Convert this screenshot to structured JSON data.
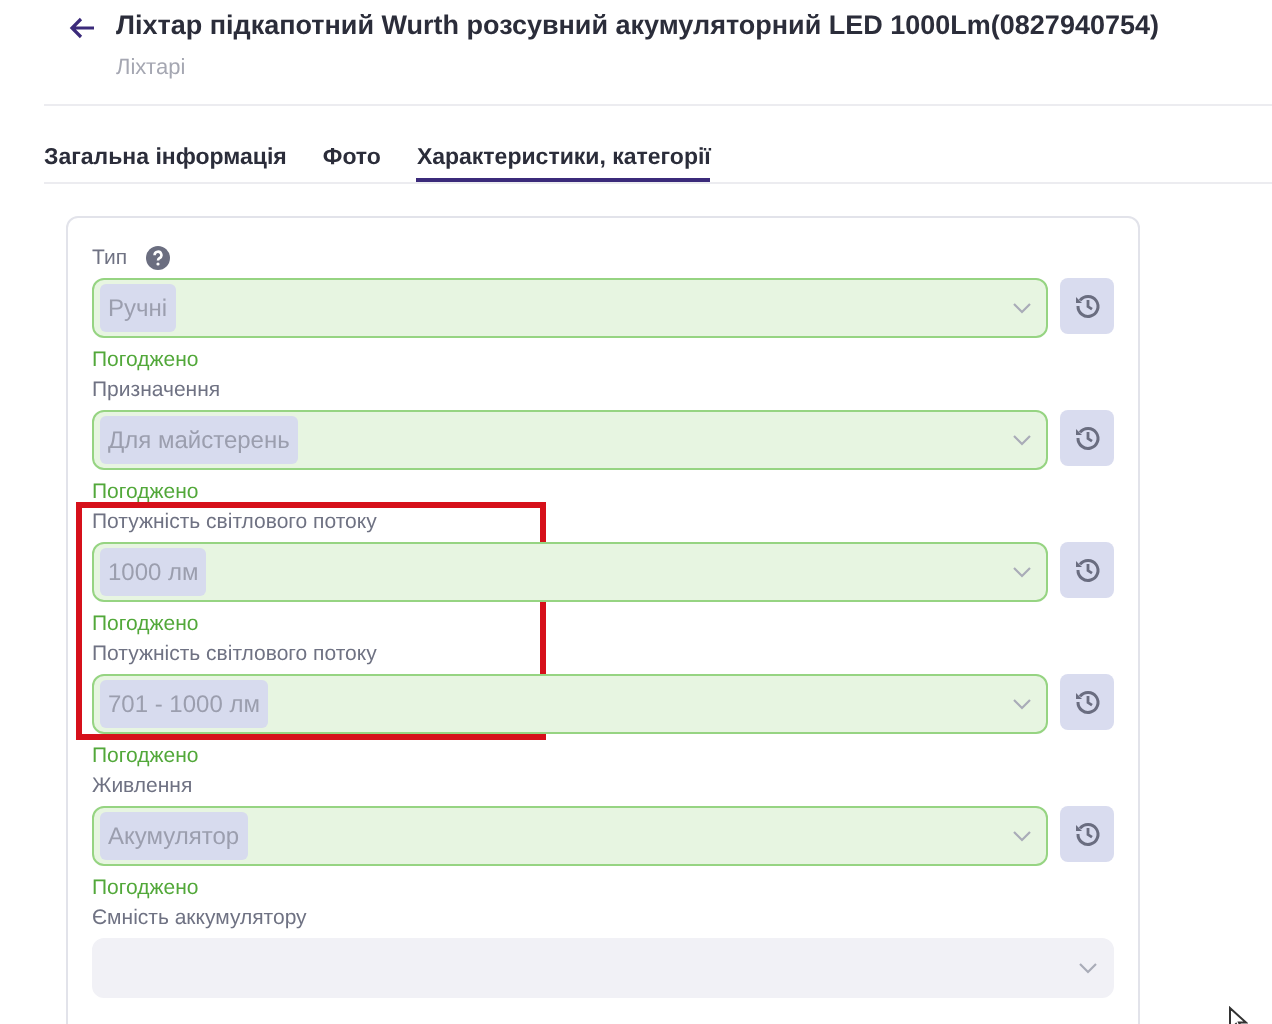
{
  "header": {
    "title": "Ліхтар підкапотний Wurth розсувний акумуляторний LED 1000Lm(0827940754)",
    "subtitle": "Ліхтарі"
  },
  "tabs": [
    {
      "label": "Загальна інформація",
      "selected": false
    },
    {
      "label": "Фото",
      "selected": false
    },
    {
      "label": "Характеристики, категорії",
      "selected": true
    }
  ],
  "fields": [
    {
      "label": "Тип",
      "help": true,
      "value": "Ручні",
      "approved": true,
      "status": "Погоджено"
    },
    {
      "label": "Призначення",
      "value": "Для майстерень",
      "approved": true,
      "status": "Погоджено"
    },
    {
      "label": "Потужність світлового потоку",
      "value": "1000 лм",
      "approved": true,
      "status": "Погоджено",
      "annotated": true
    },
    {
      "label": "Потужність світлового потоку",
      "value": "701 - 1000 лм",
      "approved": true,
      "status": "Погоджено",
      "annotated": true
    },
    {
      "label": "Живлення",
      "value": "Акумулятор",
      "approved": true,
      "status": "Погоджено"
    },
    {
      "label": "Ємність аккумулятору",
      "approved": false
    }
  ]
}
